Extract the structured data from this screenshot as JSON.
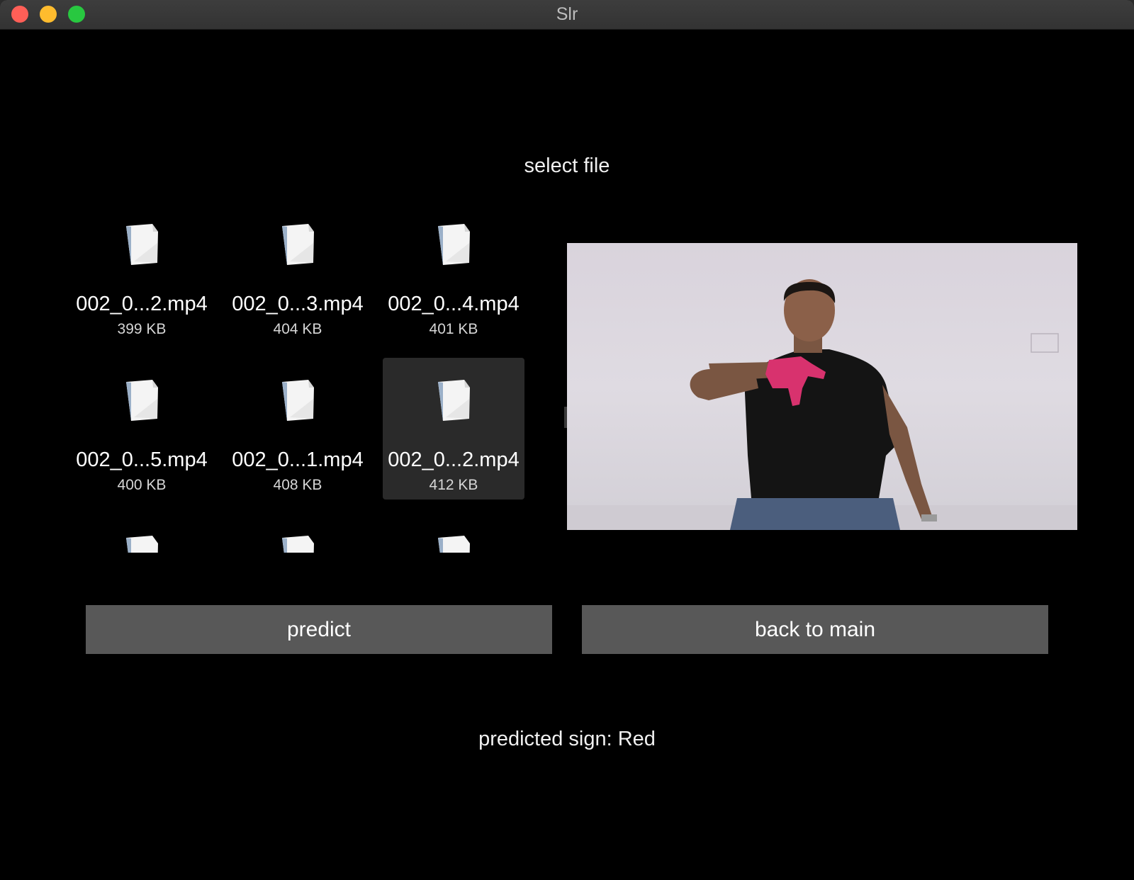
{
  "window": {
    "title": "Slr",
    "controls": {
      "close_color": "#ff5f57",
      "minimize_color": "#febc2e",
      "zoom_color": "#28c840"
    }
  },
  "main": {
    "heading": "select file",
    "files": [
      {
        "name": "002_0...2.mp4",
        "size": "399 KB",
        "icon": "document-icon",
        "selected": false
      },
      {
        "name": "002_0...3.mp4",
        "size": "404 KB",
        "icon": "document-icon",
        "selected": false
      },
      {
        "name": "002_0...4.mp4",
        "size": "401 KB",
        "icon": "document-icon",
        "selected": false
      },
      {
        "name": "002_0...5.mp4",
        "size": "400 KB",
        "icon": "document-icon",
        "selected": false
      },
      {
        "name": "002_0...1.mp4",
        "size": "408 KB",
        "icon": "document-icon",
        "selected": false
      },
      {
        "name": "002_0...2.mp4",
        "size": "412 KB",
        "icon": "document-icon",
        "selected": true
      }
    ],
    "buttons": {
      "predict": "predict",
      "back": "back to main"
    },
    "prediction": "predicted sign: Red",
    "colors": {
      "background": "#000000",
      "button": "#585858",
      "selection": "#2a2a2a",
      "glove": "#d8326e"
    }
  }
}
